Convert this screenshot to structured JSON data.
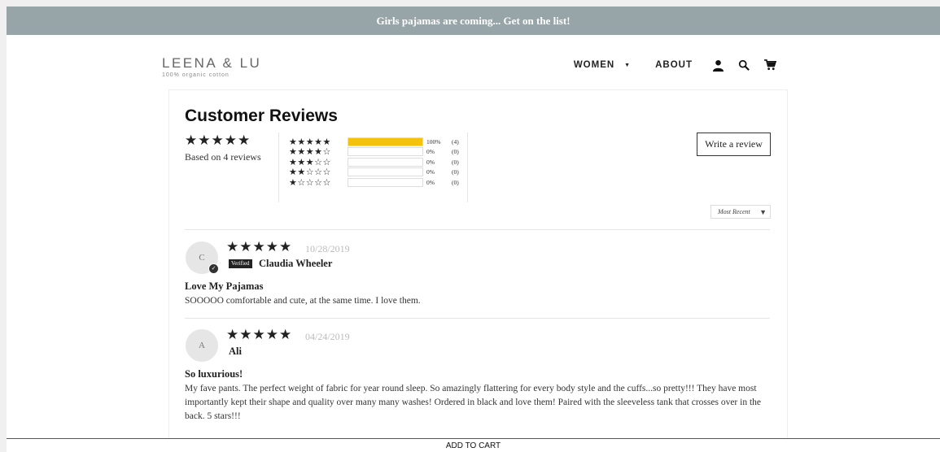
{
  "announcement": "Girls pajamas are coming... Get on the list!",
  "logo": {
    "main": "LEENA & LU",
    "tagline": "100% organic cotton"
  },
  "nav": {
    "women": "WOMEN",
    "about": "ABOUT"
  },
  "reviews": {
    "title": "Customer Reviews",
    "summary_stars": "★★★★★",
    "based_on": "Based on 4 reviews",
    "histogram": [
      {
        "stars": "★★★★★",
        "fraction": 1.0,
        "pct": "100%",
        "count": "(4)"
      },
      {
        "stars": "★★★★☆",
        "fraction": 0.0,
        "pct": "0%",
        "count": "(0)"
      },
      {
        "stars": "★★★☆☆",
        "fraction": 0.0,
        "pct": "0%",
        "count": "(0)"
      },
      {
        "stars": "★★☆☆☆",
        "fraction": 0.0,
        "pct": "0%",
        "count": "(0)"
      },
      {
        "stars": "★☆☆☆☆",
        "fraction": 0.0,
        "pct": "0%",
        "count": "(0)"
      }
    ],
    "write_review": "Write a review",
    "sort": "Most Recent",
    "items": [
      {
        "initial": "C",
        "stars": "★★★★★",
        "date": "10/28/2019",
        "verified": "Verified",
        "name": "Claudia Wheeler",
        "title": "Love My Pajamas",
        "body": "SOOOOO comfortable and cute, at the same time. I love them."
      },
      {
        "initial": "A",
        "stars": "★★★★★",
        "date": "04/24/2019",
        "name": "Ali",
        "title": "So luxurious!",
        "body": "My fave pants. The perfect weight of fabric for year round sleep. So amazingly flattering for every body style and the cuffs...so pretty!!! They have most importantly kept their shape and quality over many many washes! Ordered in black and love them! Paired with the sleeveless tank that crosses over in the back. 5 stars!!!"
      }
    ]
  },
  "cart": {
    "label": "ADD TO CART"
  },
  "colors": {
    "announcement_bg": "#98a5a8",
    "histogram_fill": "#f4c20d"
  },
  "icons": [
    "account-icon",
    "search-icon",
    "cart-icon",
    "chevron-down-icon",
    "checkmark-icon"
  ]
}
